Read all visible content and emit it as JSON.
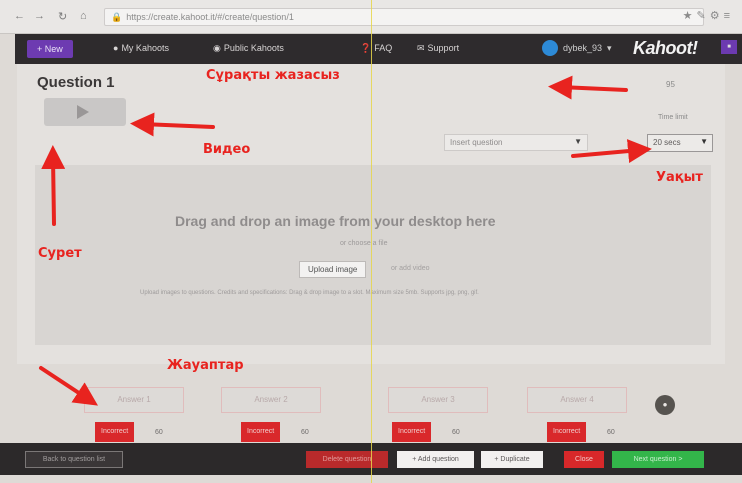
{
  "browser": {
    "url": "https://create.kahoot.it/#/create/question/1",
    "nav_icons": [
      "back-icon",
      "forward-icon",
      "reload-icon",
      "home-icon"
    ]
  },
  "appbar": {
    "new_label": "+ New",
    "links": [
      {
        "icon": "user-icon",
        "label": "My Kahoots"
      },
      {
        "icon": "globe-icon",
        "label": "Public Kahoots"
      },
      {
        "icon": "help-icon",
        "label": "FAQ"
      },
      {
        "icon": "chat-icon",
        "label": "Support"
      }
    ],
    "username": "dybek_93",
    "logo": "Kahoot!"
  },
  "question": {
    "title": "Question 1",
    "counter": "95",
    "type_placeholder": "Insert question",
    "time_limit_label": "Time limit",
    "time_limit_value": "20 secs"
  },
  "dropzone": {
    "title": "Drag and drop an image from your desktop here",
    "or_text": "or choose a file",
    "upload_button": "Upload image",
    "upload_note": "or add video",
    "help_text": "Upload images to questions. Credits and specifications: Drag & drop image to a slot. Maximum size 5mb. Supports jpg, png, gif."
  },
  "answers": [
    {
      "label": "Answer 1",
      "correct_label": "Incorrect",
      "count": "60"
    },
    {
      "label": "Answer 2",
      "correct_label": "Incorrect",
      "count": "60"
    },
    {
      "label": "Answer 3",
      "correct_label": "Incorrect",
      "count": "60"
    },
    {
      "label": "Answer 4",
      "correct_label": "Incorrect",
      "count": "60"
    }
  ],
  "bottombar": {
    "back_label": "Back to question list",
    "delete_label": "Delete question",
    "add_label": "+ Add question",
    "duplicate_label": "+ Duplicate",
    "close_label": "Close",
    "next_label": "Next question >"
  },
  "annotations": {
    "question_line": "Сұрақты жазасыз",
    "video": "Видео",
    "image": "Сурет",
    "time": "Уақыт",
    "answers": "Жауаптар"
  },
  "colors": {
    "annotation_red": "#e8231f",
    "appbar_dark": "#2e2b2d",
    "kahoot_purple": "#6d3bb1",
    "correct_red": "#d9282b",
    "next_green": "#33b54a"
  }
}
